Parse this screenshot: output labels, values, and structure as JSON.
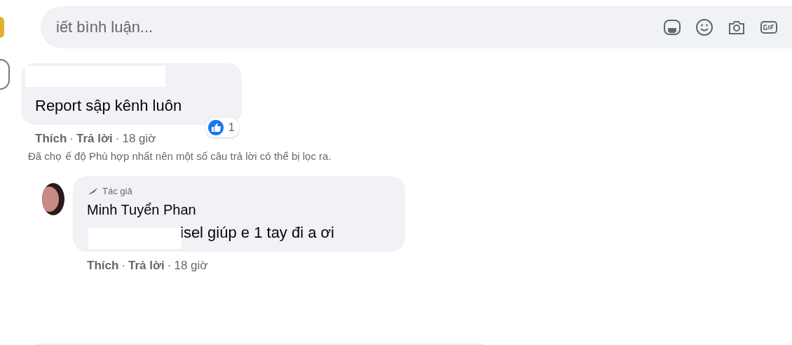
{
  "composer": {
    "placeholder": "iết bình luận..."
  },
  "separator": "·",
  "comments": [
    {
      "text": "Report sập kênh luôn",
      "reaction_count": "1",
      "actions": [
        "Thích",
        "Trả lời"
      ],
      "time": "18 giờ"
    }
  ],
  "filter_note": [
    "Đã chọ",
    "ế độ Phù hợp nhất nên một số câu trả lời có thể bị lọc ra."
  ],
  "replies": [
    {
      "badge": "Tác giả",
      "author": "Minh Tuyển Phan",
      "text": "isel giúp e 1 tay đi a ơi",
      "actions": [
        "Thích",
        "Trả lời"
      ],
      "time": "18 giờ"
    }
  ]
}
